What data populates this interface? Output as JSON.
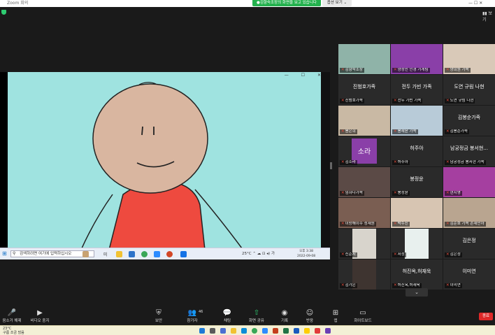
{
  "titlebar": {
    "title": "Zoom 회의",
    "share_banner": "●김향숙조장의 화면을 보고 있습니다",
    "view_options": "옵션 보기 ⌄",
    "right_controls": "—  ☐  ✕"
  },
  "top_right": {
    "icon1": "▮▮ 보기",
    "icon2": "⤢"
  },
  "shared_screen": {
    "window_controls": "—  ☐  ✕",
    "taskbar": {
      "search_placeholder": "검색하려면 여기에 입력하십시오",
      "text_label": "미",
      "temperature": "25°C  ⌃  ☁  ⊡  ◂)  가",
      "clock": "오후 3:38\n2022-09-08"
    }
  },
  "gallery": {
    "tiles": [
      {
        "name": "김향숙조장",
        "big": "",
        "kind": "video",
        "bg": "#8fb3a8"
      },
      {
        "name": "양정민 인경 가게팀",
        "big": "",
        "kind": "video",
        "bg": "#8a3fa8"
      },
      {
        "name": "양희원 가족",
        "big": "",
        "kind": "video",
        "bg": "#d9c9b8"
      },
      {
        "name": "진범호가족",
        "big": "진범호가족",
        "kind": "name"
      },
      {
        "name": "전두 가빈 가족",
        "big": "전두 가빈 가족",
        "kind": "name"
      },
      {
        "name": "도연 규림 나현",
        "big": "도연 규림 나현",
        "kind": "name"
      },
      {
        "name": "봉은희",
        "big": "",
        "kind": "video",
        "bg": "#c9b9a4"
      },
      {
        "name": "봉재윤 가족",
        "big": "",
        "kind": "video",
        "bg": "#b8cbd8"
      },
      {
        "name": "김봉순가족",
        "big": "김봉순가족",
        "kind": "name"
      },
      {
        "name": "김소라",
        "big": "소라",
        "kind": "purple"
      },
      {
        "name": "허주아",
        "big": "허주아",
        "kind": "name"
      },
      {
        "name": "남궁정금 봉서현 가족",
        "big": "남궁정금 봉서현...",
        "kind": "name"
      },
      {
        "name": "임하나가족",
        "big": "",
        "kind": "video",
        "bg": "#5b4a46"
      },
      {
        "name": "봉정윤",
        "big": "봉정윤",
        "kind": "name"
      },
      {
        "name": "현지영",
        "big": "",
        "kind": "video",
        "bg": "#a53fa0"
      },
      {
        "name": "이랑해이주 성재원",
        "big": "",
        "kind": "video",
        "bg": "#7a5e52"
      },
      {
        "name": "박수진",
        "big": "",
        "kind": "video",
        "bg": "#d7c5b2"
      },
      {
        "name": "김준호 가족 손재민아",
        "big": "",
        "kind": "video",
        "bg": "#b9a590"
      },
      {
        "name": "신준서",
        "big": "",
        "kind": "video",
        "bg": "#d8d4cc"
      },
      {
        "name": "서정",
        "big": "",
        "kind": "video",
        "bg": "#e8f0ee"
      },
      {
        "name": "김은정",
        "big": "김은정",
        "kind": "name"
      },
      {
        "name": "김가은",
        "big": "",
        "kind": "video",
        "bg": "#3e3430"
      },
      {
        "name": "허진옥,허재욱",
        "big": "허진옥,허재욱",
        "kind": "name"
      },
      {
        "name": "이미연",
        "big": "이미연",
        "kind": "name"
      }
    ],
    "page_down": "⌄"
  },
  "toolbar": {
    "items": [
      {
        "label": "음소거 해제",
        "icon": "🎤"
      },
      {
        "label": "비디오 중지",
        "icon": "▶"
      },
      {
        "label": "보안",
        "icon": "⛨"
      },
      {
        "label": "참가자",
        "icon": "👥"
      },
      {
        "label": "채팅",
        "icon": "💬"
      },
      {
        "label": "화면 공유",
        "icon": "⇧"
      },
      {
        "label": "기록",
        "icon": "◉"
      },
      {
        "label": "반응",
        "icon": "☺"
      },
      {
        "label": "앱",
        "icon": "⊞"
      },
      {
        "label": "화이트보드",
        "icon": "▭"
      }
    ],
    "participants_count": "46",
    "end": "종료"
  },
  "os_taskbar": {
    "temp": "23°C",
    "weather_desc": "구름 조금 많음"
  },
  "colors": {
    "accent_green": "#23b14d",
    "end_red": "#e02828",
    "tile_border": "#e8e23b"
  }
}
